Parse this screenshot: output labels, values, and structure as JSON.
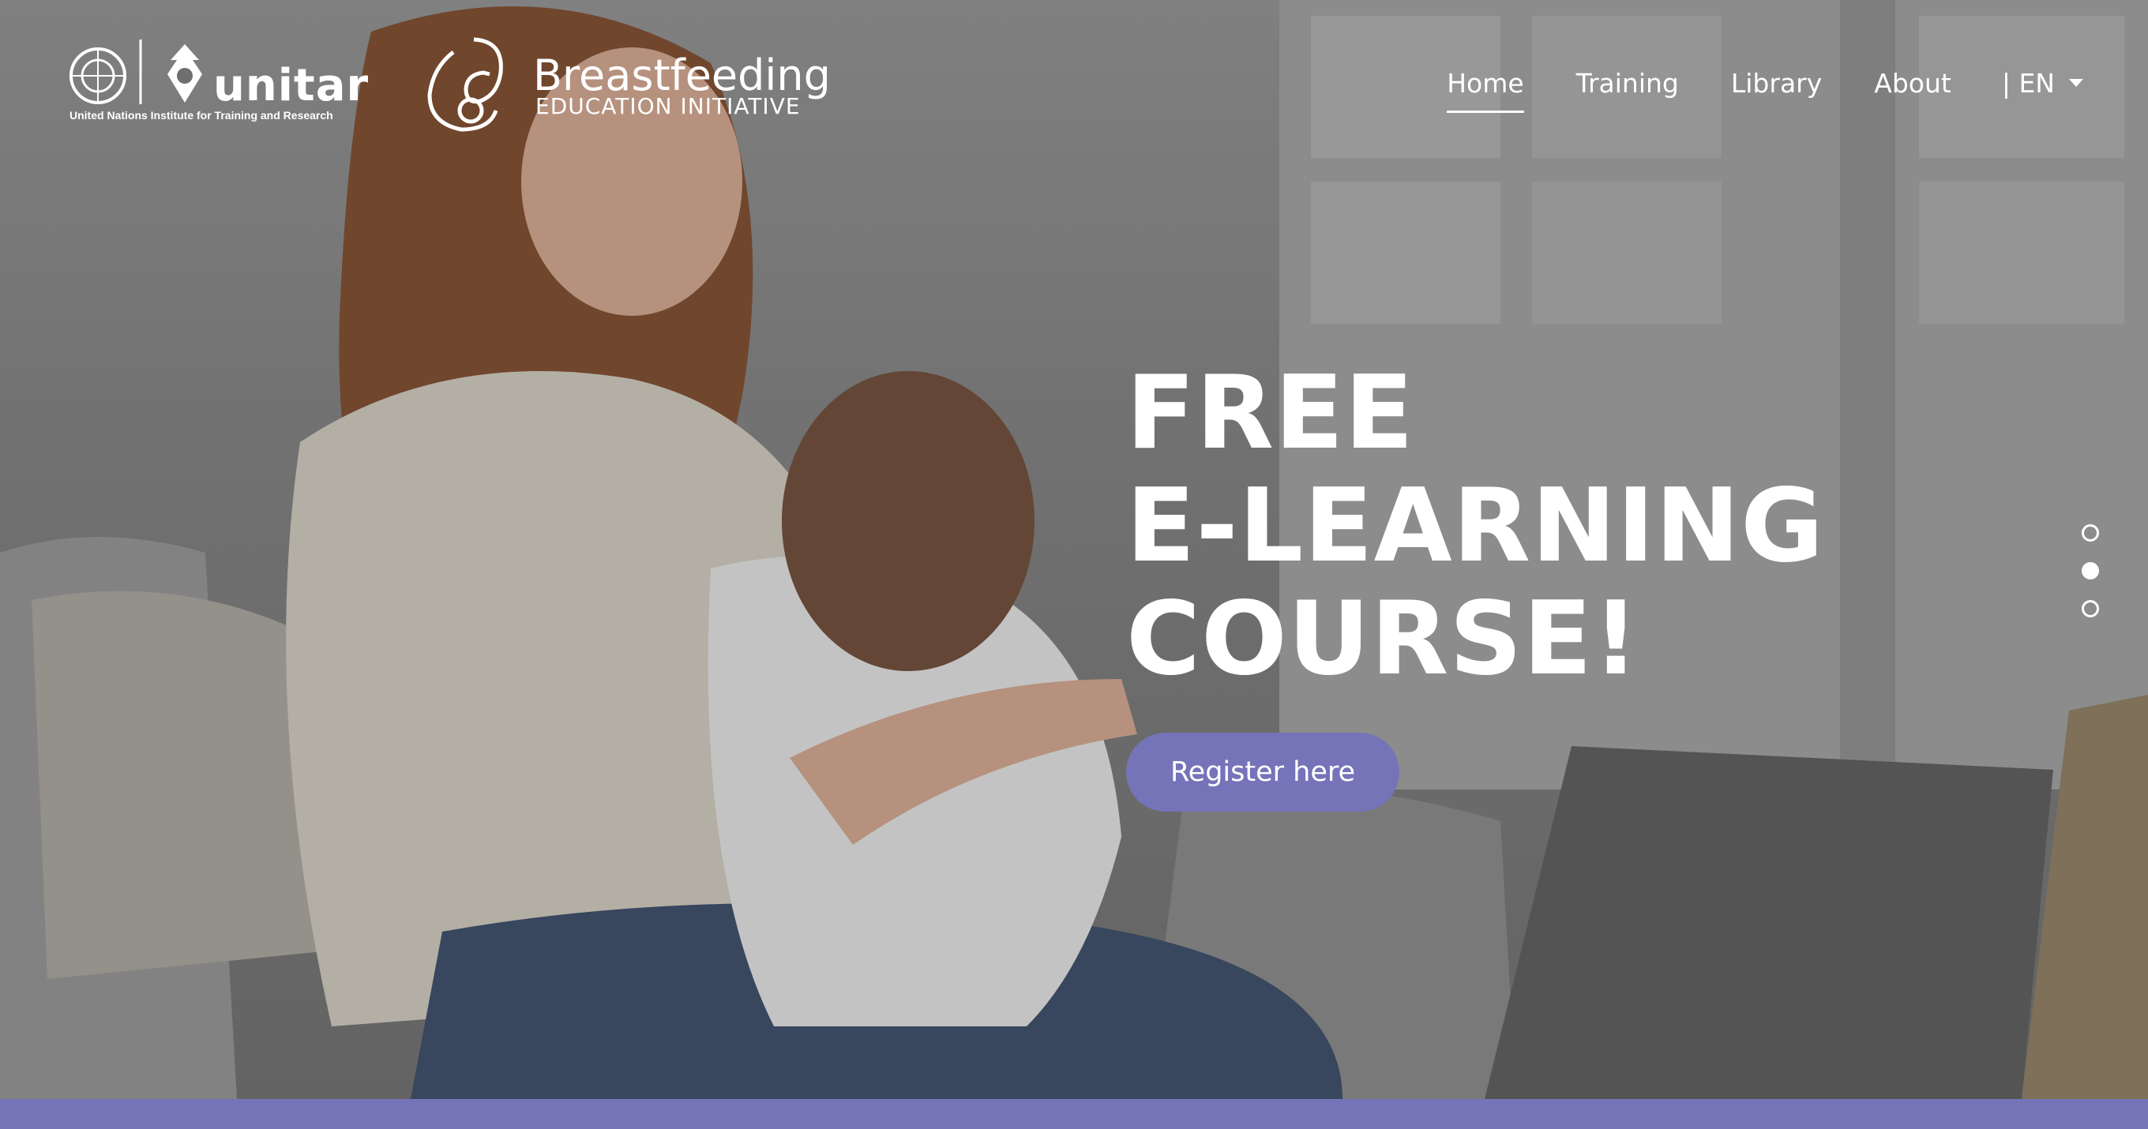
{
  "brand": {
    "unitar_word": "unitar",
    "unitar_subtitle": "United Nations Institute for Training and Research",
    "initiative_title": "Breastfeeding",
    "initiative_subtitle": "EDUCATION INITIATIVE"
  },
  "nav": {
    "items": [
      {
        "label": "Home",
        "active": true
      },
      {
        "label": "Training",
        "active": false
      },
      {
        "label": "Library",
        "active": false
      },
      {
        "label": "About",
        "active": false
      }
    ],
    "language": "| EN"
  },
  "hero": {
    "headline_lines": [
      "FREE",
      "E-LEARNING",
      "COURSE!"
    ],
    "cta_label": "Register here",
    "slides": {
      "count": 3,
      "active_index": 1
    }
  },
  "colors": {
    "accent": "#7574b9",
    "text": "#ffffff"
  },
  "icons": [
    "un-emblem-icon",
    "unitar-emblem-icon",
    "breastfeeding-logo-icon",
    "caret-down-icon"
  ]
}
